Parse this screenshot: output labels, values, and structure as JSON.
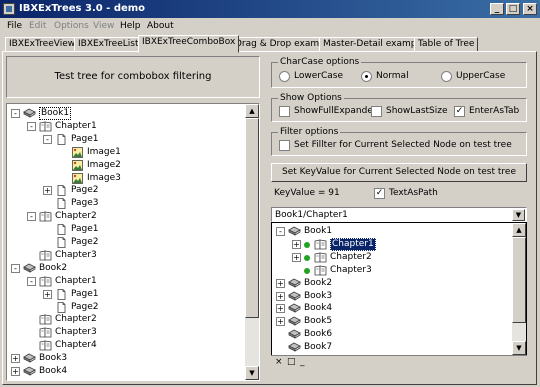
{
  "window": {
    "title": "IBXExTrees 3.0 - demo",
    "min": "_",
    "max": "□",
    "close": "×"
  },
  "menu": [
    {
      "label": "File",
      "enabled": true
    },
    {
      "label": "Edit",
      "enabled": false
    },
    {
      "label": "Options",
      "enabled": false
    },
    {
      "label": "View",
      "enabled": false
    },
    {
      "label": "Help",
      "enabled": true
    },
    {
      "label": "About",
      "enabled": true
    }
  ],
  "tabs": [
    "IBXExTreeView",
    "IBXExTreeList",
    "IBXExTreeComboBox",
    "Drag & Drop example",
    "Master-Detail example",
    "Table of Tree"
  ],
  "active_tab": 2,
  "left": {
    "header": "Test tree for combobox filtering",
    "tree": [
      {
        "label": "Book1",
        "type": "book",
        "level": 0,
        "exp": "-",
        "state": "sel"
      },
      {
        "label": "Chapter1",
        "type": "chapter",
        "level": 1,
        "exp": "-"
      },
      {
        "label": "Page1",
        "type": "page",
        "level": 2,
        "exp": "-"
      },
      {
        "label": "Image1",
        "type": "image",
        "level": 3
      },
      {
        "label": "Image2",
        "type": "image",
        "level": 3
      },
      {
        "label": "Image3",
        "type": "image",
        "level": 3
      },
      {
        "label": "Page2",
        "type": "page",
        "level": 2,
        "exp": "+"
      },
      {
        "label": "Page3",
        "type": "page",
        "level": 2
      },
      {
        "label": "Chapter2",
        "type": "chapter",
        "level": 1,
        "exp": "-"
      },
      {
        "label": "Page1",
        "type": "page",
        "level": 2
      },
      {
        "label": "Page2",
        "type": "page",
        "level": 2
      },
      {
        "label": "Chapter3",
        "type": "chapter",
        "level": 1
      },
      {
        "label": "Book2",
        "type": "book",
        "level": 0,
        "exp": "-"
      },
      {
        "label": "Chapter1",
        "type": "chapter",
        "level": 1,
        "exp": "-"
      },
      {
        "label": "Page1",
        "type": "page",
        "level": 2,
        "exp": "+"
      },
      {
        "label": "Page2",
        "type": "page",
        "level": 2
      },
      {
        "label": "Chapter2",
        "type": "chapter",
        "level": 1
      },
      {
        "label": "Chapter3",
        "type": "chapter",
        "level": 1
      },
      {
        "label": "Chapter4",
        "type": "chapter",
        "level": 1
      },
      {
        "label": "Book3",
        "type": "book",
        "level": 0,
        "exp": "+"
      },
      {
        "label": "Book4",
        "type": "book",
        "level": 0,
        "exp": "+"
      }
    ]
  },
  "charcase": {
    "title": "CharCase options",
    "options": [
      {
        "label": "LowerCase",
        "checked": false
      },
      {
        "label": "Normal",
        "checked": true
      },
      {
        "label": "UpperCase",
        "checked": false
      }
    ]
  },
  "show": {
    "title": "Show Options",
    "options": [
      {
        "label": "ShowFullExpanded",
        "checked": false
      },
      {
        "label": "ShowLastSize",
        "checked": false
      },
      {
        "label": "EnterAsTab",
        "checked": true
      }
    ]
  },
  "filter": {
    "title": "Filter options",
    "option": {
      "label": "Set Fillter for Current Selected Node on test tree",
      "checked": false
    }
  },
  "set_button": "Set KeyValue for Current Selected Node on test tree",
  "keyvalue": "KeyValue = 91",
  "textaspath": {
    "label": "TextAsPath",
    "checked": true
  },
  "combo_value": "Book1/Chapter1",
  "dropdown": [
    {
      "label": "Book1",
      "type": "book",
      "level": 0,
      "exp": "-"
    },
    {
      "label": "Chapter1",
      "type": "chapter",
      "level": 1,
      "exp": "+",
      "dot": true,
      "state": "hl"
    },
    {
      "label": "Chapter2",
      "type": "chapter",
      "level": 1,
      "exp": "+",
      "dot": true
    },
    {
      "label": "Chapter3",
      "type": "chapter",
      "level": 1,
      "dot": true
    },
    {
      "label": "Book2",
      "type": "book",
      "level": 0,
      "exp": "+"
    },
    {
      "label": "Book3",
      "type": "book",
      "level": 0,
      "exp": "+"
    },
    {
      "label": "Book4",
      "type": "book",
      "level": 0,
      "exp": "+"
    },
    {
      "label": "Book5",
      "type": "book",
      "level": 0,
      "exp": "+"
    },
    {
      "label": "Book6",
      "type": "book",
      "level": 0
    },
    {
      "label": "Book7",
      "type": "book",
      "level": 0
    }
  ],
  "dropdown_footer": [
    "×",
    "□",
    "_"
  ],
  "icons": {
    "book": "book-icon",
    "chapter": "chapter-icon",
    "page": "page-icon",
    "image": "image-icon"
  },
  "colors": {
    "title_start": "#0a246a",
    "title_end": "#3a6ea5",
    "selection": "#0a246a",
    "face": "#d4d0c8",
    "dot": "#21a321"
  }
}
